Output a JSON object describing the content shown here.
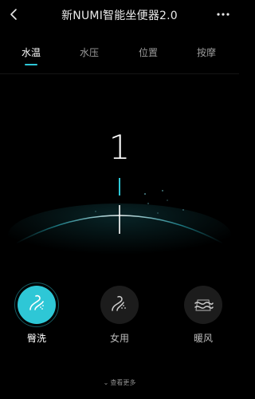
{
  "header": {
    "title": "新NUMI智能坐便器2.0"
  },
  "tabs": [
    {
      "label": "水温"
    },
    {
      "label": "水压"
    },
    {
      "label": "位置"
    },
    {
      "label": "按摩"
    }
  ],
  "dial": {
    "value": "1"
  },
  "modes": [
    {
      "label": "臀洗",
      "icon": "rear-wash-icon",
      "active": true
    },
    {
      "label": "女用",
      "icon": "feminine-wash-icon",
      "active": false
    },
    {
      "label": "暖风",
      "icon": "warm-air-dryer-icon",
      "active": false
    }
  ],
  "footer": {
    "see_more": "查看更多"
  },
  "colors": {
    "accent": "#2ec7d6",
    "background": "#000000",
    "text": "#ffffff",
    "muted_text": "#9a9a9a"
  }
}
